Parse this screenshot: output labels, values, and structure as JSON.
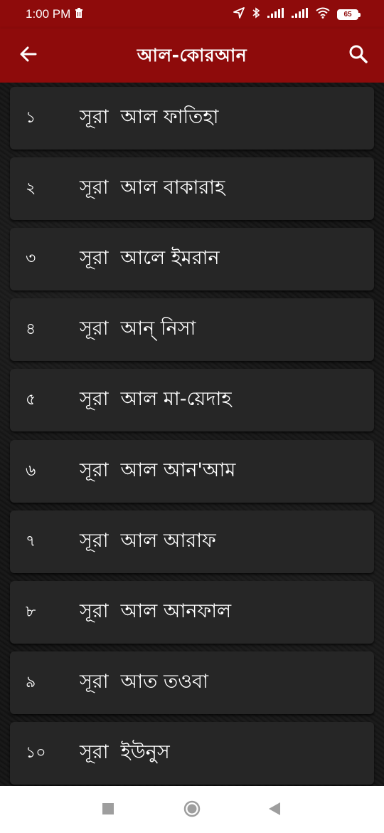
{
  "status_bar": {
    "time": "1:00 PM",
    "battery": "65"
  },
  "app_bar": {
    "title": "আল-কোরআন"
  },
  "surahs": [
    {
      "number": "১",
      "name": "সূরা  আল ফাতিহা"
    },
    {
      "number": "২",
      "name": "সূরা  আল বাকারাহ"
    },
    {
      "number": "৩",
      "name": "সূরা  আলে ইমরান"
    },
    {
      "number": "৪",
      "name": "সূরা  আন্ নিসা"
    },
    {
      "number": "৫",
      "name": "সূরা  আল মা-য়েদাহ"
    },
    {
      "number": "৬",
      "name": "সূরা  আল আন'আম"
    },
    {
      "number": "৭",
      "name": "সূরা  আল আরাফ"
    },
    {
      "number": "৮",
      "name": "সূরা  আল আনফাল"
    },
    {
      "number": "৯",
      "name": "সূরা  আত তওবা"
    },
    {
      "number": "১০",
      "name": "সূরা  ইউনুস"
    }
  ],
  "colors": {
    "app_bar": "#8e0b0b",
    "row_background": "#262626",
    "text": "#ffffff"
  },
  "icons": {
    "back": "arrow-left-icon",
    "search": "search-icon",
    "nav_recents": "square-icon",
    "nav_home": "circle-icon",
    "nav_back": "triangle-left-icon"
  }
}
